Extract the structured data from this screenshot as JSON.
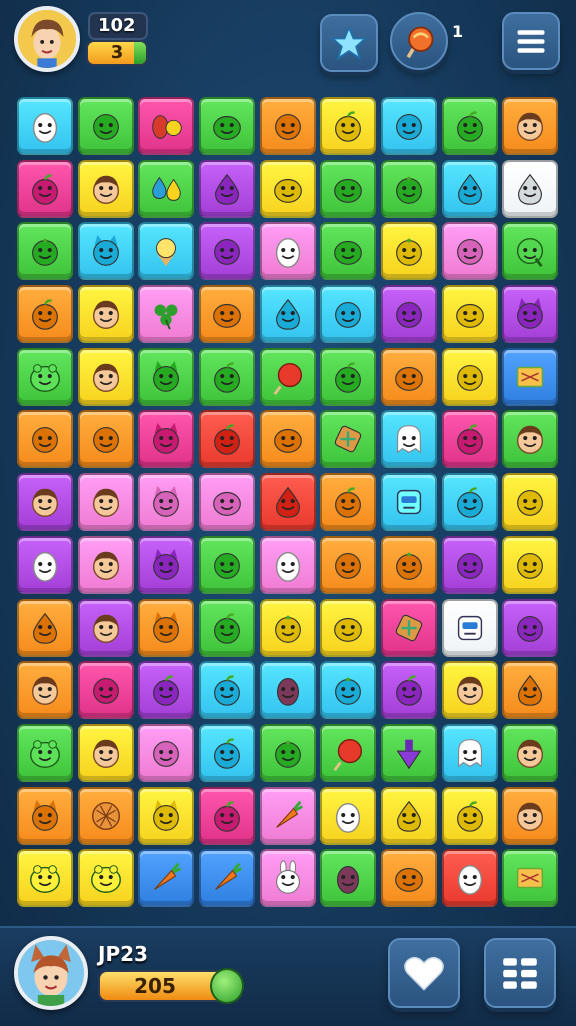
{
  "header": {
    "score": "102",
    "level": "3",
    "moves_badge": "1",
    "avatar_icon": "boy-avatar-icon",
    "star_icon": "star-icon",
    "lollipop_icon": "lollipop-icon",
    "menu_icon": "hamburger-menu-icon"
  },
  "footer": {
    "player_name": "JP23",
    "coins": "205",
    "avatar_icon": "fox-boy-avatar-icon",
    "heart_icon": "heart-icon",
    "grid_icon": "grid-menu-icon",
    "coin_icon": "leaf-coin-icon"
  },
  "board": {
    "rows": 13,
    "cols": 9,
    "colors": {
      "cyan": "#33c3ef",
      "green": "#3fc33a",
      "magenta": "#e0338a",
      "yellow": "#f7d21e",
      "orange": "#f58b1c",
      "red": "#ea3a2e",
      "purple": "#a33fd6",
      "pink": "#f07bd2",
      "white": "#eef3f6",
      "blue": "#2f7fe0"
    },
    "tiles": [
      [
        "cyan:egg",
        "green:face",
        "magenta:fruits",
        "green:lemon",
        "orange:face",
        "yellow:apple",
        "cyan:face",
        "green:apple",
        "orange:person"
      ],
      [
        "magenta:apple",
        "yellow:person",
        "green:drops",
        "purple:drop",
        "yellow:lemon",
        "green:lemon",
        "green:orange",
        "cyan:drop",
        "white:drop"
      ],
      [
        "green:orange",
        "cyan:cat",
        "cyan:icecream",
        "purple:face",
        "pink:egg",
        "green:lemon",
        "yellow:orange",
        "pink:face",
        "green:plant"
      ],
      [
        "orange:apple",
        "yellow:person",
        "pink:clover",
        "orange:lemon",
        "cyan:drop",
        "cyan:face",
        "purple:face",
        "yellow:lemon",
        "purple:cat"
      ],
      [
        "green:frog",
        "yellow:person",
        "green:cat",
        "green:apple",
        "green:lolly",
        "green:apple",
        "orange:lemon",
        "yellow:face",
        "blue:box"
      ],
      [
        "orange:face",
        "orange:face",
        "magenta:cat",
        "red:apple",
        "orange:lemon",
        "green:candy",
        "cyan:ghost",
        "magenta:apple",
        "green:person"
      ],
      [
        "purple:person",
        "pink:person",
        "pink:cat",
        "pink:lemon",
        "red:drop",
        "orange:apple",
        "cyan:robot",
        "cyan:apple",
        "yellow:face"
      ],
      [
        "purple:egg",
        "pink:person",
        "purple:cat",
        "green:face",
        "pink:egg",
        "orange:face",
        "orange:orange",
        "purple:face",
        "yellow:face"
      ],
      [
        "orange:drop",
        "purple:person",
        "orange:cat",
        "green:apple",
        "yellow:orange",
        "yellow:lemon",
        "magenta:candy",
        "white:robot",
        "purple:face"
      ],
      [
        "orange:person",
        "magenta:face",
        "purple:apple",
        "cyan:apple",
        "cyan:plum",
        "cyan:orange",
        "purple:apple",
        "yellow:person",
        "orange:drop"
      ],
      [
        "green:frog",
        "yellow:person",
        "pink:face",
        "cyan:apple",
        "green:orange",
        "green:lolly",
        "green:top",
        "cyan:ghost",
        "green:person"
      ],
      [
        "orange:cat",
        "orange:waffle",
        "yellow:cat",
        "magenta:apple",
        "pink:carrot",
        "yellow:egg",
        "yellow:drop",
        "yellow:apple",
        "orange:person"
      ],
      [
        "yellow:frog",
        "yellow:frog",
        "blue:carrot",
        "blue:carrot",
        "pink:rabbit",
        "green:plum",
        "orange:lemon",
        "red:egg",
        "green:box"
      ]
    ]
  }
}
